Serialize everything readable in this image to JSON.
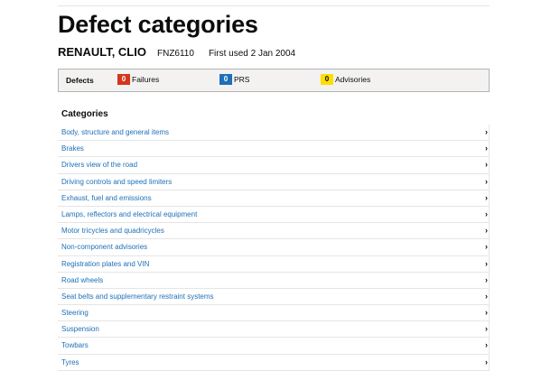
{
  "page": {
    "title": "Defect categories"
  },
  "vehicle": {
    "name": "RENAULT, CLIO",
    "registration": "FNZ6110",
    "first_used": "First used 2 Jan 2004"
  },
  "summary": {
    "defects_label": "Defects",
    "failures": {
      "count": "0",
      "label": "Failures",
      "color": "#d4351c"
    },
    "prs": {
      "count": "0",
      "label": "PRS",
      "color": "#1d70b8"
    },
    "advisories": {
      "count": "0",
      "label": "Advisories",
      "color": "#ffdd00"
    }
  },
  "categories": {
    "heading": "Categories",
    "chevron": "›",
    "items": [
      "Body, structure and general items",
      "Brakes",
      "Drivers view of the road",
      "Driving controls and speed limiters",
      "Exhaust, fuel and emissions",
      "Lamps, reflectors and electrical equipment",
      "Motor tricycles and quadricycles",
      "Non-component advisories",
      "Registration plates and VIN",
      "Road wheels",
      "Seat belts and supplementary restraint systems",
      "Steering",
      "Suspension",
      "Towbars",
      "Tyres"
    ]
  }
}
